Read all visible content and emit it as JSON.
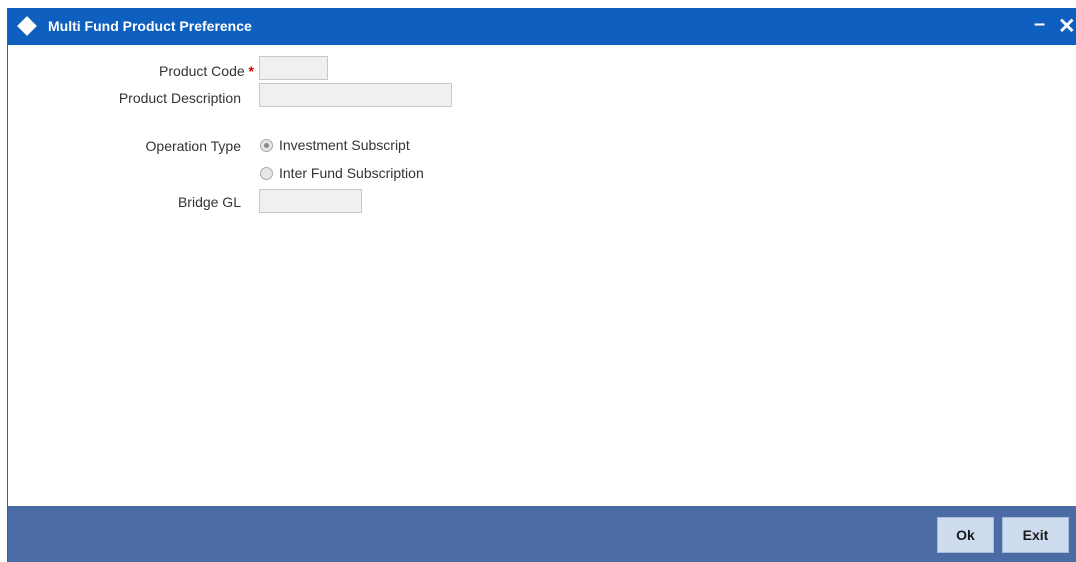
{
  "window": {
    "title": "Multi Fund Product Preference",
    "minimize_glyph": "–",
    "close_glyph": "✕"
  },
  "form": {
    "product_code": {
      "label": "Product Code",
      "required_mark": "*",
      "value": ""
    },
    "product_description": {
      "label": "Product Description",
      "value": ""
    },
    "operation_type": {
      "label": "Operation Type",
      "options": [
        {
          "label": "Investment Subscript",
          "selected": true
        },
        {
          "label": "Inter Fund Subscription",
          "selected": false
        }
      ]
    },
    "bridge_gl": {
      "label": "Bridge GL",
      "value": ""
    }
  },
  "footer": {
    "ok_label": "Ok",
    "exit_label": "Exit"
  },
  "colors": {
    "titlebar": "#0f5fbf",
    "footer": "#4b6ba5",
    "required": "#d40000"
  }
}
